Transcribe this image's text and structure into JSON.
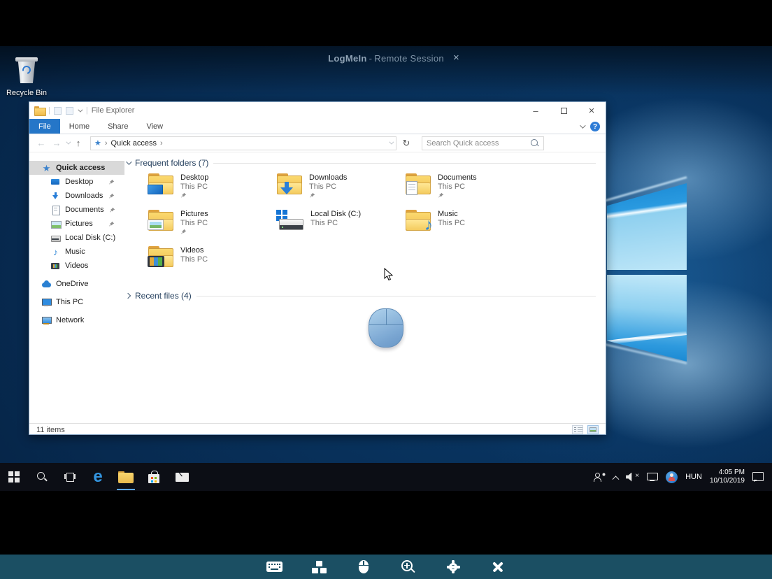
{
  "remote_header": {
    "brand": "LogMeIn",
    "separator": "-",
    "title": "Remote Session",
    "close_glyph": "×"
  },
  "desktop": {
    "recycle_bin_label": "Recycle Bin"
  },
  "glyphs": {
    "star": "★",
    "music_note": "♪",
    "back": "←",
    "forward": "→",
    "up": "↑",
    "refresh": "↻",
    "crumb_sep": "›",
    "minimize": "–",
    "close": "×",
    "help": "?",
    "edge_e": "e",
    "qat_sep": "|"
  },
  "explorer": {
    "window_title": "File Explorer",
    "tabs": [
      {
        "label": "File",
        "active": true
      },
      {
        "label": "Home",
        "active": false
      },
      {
        "label": "Share",
        "active": false
      },
      {
        "label": "View",
        "active": false
      }
    ],
    "address": {
      "crumb": "Quick access"
    },
    "search": {
      "placeholder": "Search Quick access"
    },
    "sidebar": [
      {
        "label": "Quick access",
        "selected": true
      },
      {
        "label": "Desktop",
        "pinned": true
      },
      {
        "label": "Downloads",
        "pinned": true
      },
      {
        "label": "Documents",
        "pinned": true
      },
      {
        "label": "Pictures",
        "pinned": true
      },
      {
        "label": "Local Disk (C:)",
        "pinned": false
      },
      {
        "label": "Music",
        "pinned": false
      },
      {
        "label": "Videos",
        "pinned": false
      },
      {
        "label": "OneDrive",
        "pinned": false
      },
      {
        "label": "This PC",
        "pinned": false
      },
      {
        "label": "Network",
        "pinned": false
      }
    ],
    "sections": {
      "frequent": "Frequent folders (7)",
      "recent": "Recent files (4)"
    },
    "tiles": [
      {
        "name": "Desktop",
        "location": "This PC",
        "pinned": true
      },
      {
        "name": "Downloads",
        "location": "This PC",
        "pinned": true
      },
      {
        "name": "Documents",
        "location": "This PC",
        "pinned": true
      },
      {
        "name": "Pictures",
        "location": "This PC",
        "pinned": true
      },
      {
        "name": "Local Disk (C:)",
        "location": "This PC",
        "pinned": false
      },
      {
        "name": "Music",
        "location": "This PC",
        "pinned": false
      },
      {
        "name": "Videos",
        "location": "This PC",
        "pinned": false
      }
    ],
    "status": {
      "items": "11 items"
    }
  },
  "taskbar": {
    "tray": {
      "language": "HUN",
      "time": "4:05 PM",
      "date": "10/10/2019"
    }
  },
  "control_bar": {
    "buttons": [
      "keyboard",
      "apps",
      "mouse",
      "zoom-in",
      "settings",
      "close"
    ]
  },
  "colors": {
    "accent_blue": "#2576c8",
    "control_bar_teal": "#1b4f63",
    "taskbar_dark": "#0c0e15",
    "selection_gray": "#d9d9d9"
  }
}
